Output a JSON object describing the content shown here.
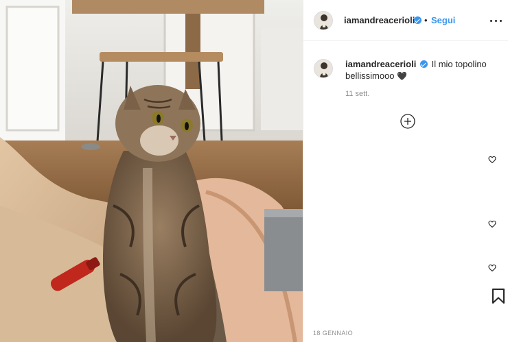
{
  "post": {
    "photo_alt": "tabby cat sitting",
    "header": {
      "username": "iamandreacerioli",
      "verified": true,
      "separator": "•",
      "follow_label": "Segui"
    },
    "caption": {
      "username": "iamandreacerioli",
      "text_line1": "Il mio topolino",
      "text_line2": "bellissimooo",
      "emoji": "🖤"
    },
    "timestamp": "11 sett.",
    "footer_date": "18 gennaio",
    "icons": {
      "more": "more-options-icon",
      "load_more": "plus-circle-icon",
      "like": "heart-icon",
      "save": "bookmark-icon",
      "verified": "verified-badge-icon"
    },
    "colors": {
      "link": "#3897f0",
      "text": "#262626",
      "muted": "#8e8e8e"
    }
  }
}
